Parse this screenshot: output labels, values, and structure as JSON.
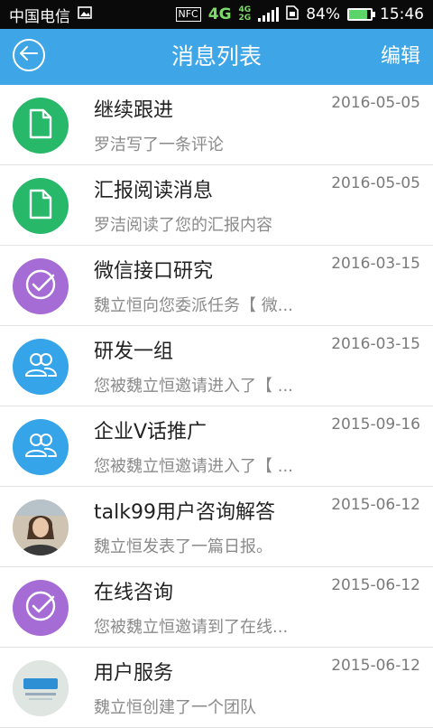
{
  "status_bar": {
    "carrier": "中国电信",
    "nfc": "NFC",
    "network": "4G",
    "network_small_top": "4G",
    "network_small_bottom": "2G",
    "battery": "84%",
    "time": "15:46"
  },
  "header": {
    "title": "消息列表",
    "edit_label": "编辑"
  },
  "messages": [
    {
      "title": "继续跟进",
      "subtitle": "罗洁写了一条评论",
      "date": "2016-05-05",
      "icon": "document-icon",
      "color": "#27b86a"
    },
    {
      "title": "汇报阅读消息",
      "subtitle": "罗洁阅读了您的汇报内容",
      "date": "2016-05-05",
      "icon": "document-icon",
      "color": "#27b86a"
    },
    {
      "title": "微信接口研究",
      "subtitle": "魏立恒向您委派任务【 微...",
      "date": "2016-03-15",
      "icon": "check-icon",
      "color": "#a66cd6"
    },
    {
      "title": "研发一组",
      "subtitle": "您被魏立恒邀请进入了【 ...",
      "date": "2016-03-15",
      "icon": "group-icon",
      "color": "#35a4e8"
    },
    {
      "title": "企业V话推广",
      "subtitle": "您被魏立恒邀请进入了【 ...",
      "date": "2015-09-16",
      "icon": "group-icon",
      "color": "#35a4e8"
    },
    {
      "title": "talk99用户咨询解答",
      "subtitle": "魏立恒发表了一篇日报。",
      "date": "2015-06-12",
      "icon": "user-photo-avatar",
      "color": "#c9b79a"
    },
    {
      "title": "在线咨询",
      "subtitle": "您被魏立恒邀请到了在线...",
      "date": "2015-06-12",
      "icon": "check-icon",
      "color": "#a66cd6"
    },
    {
      "title": "用户服务",
      "subtitle": "魏立恒创建了一个团队",
      "date": "2015-06-12",
      "icon": "team-logo-avatar",
      "color": "#cfd8d2"
    }
  ]
}
